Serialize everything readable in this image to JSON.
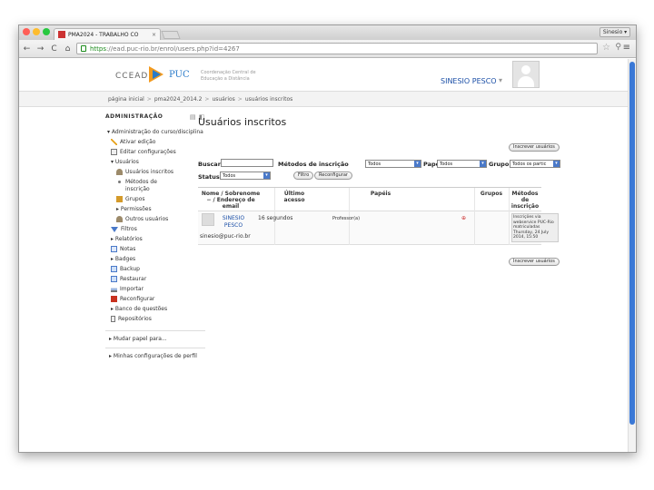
{
  "browser": {
    "tab_title": "PMA2024 - TRABALHO CO",
    "tab_close": "×",
    "user_badge": "Sinesio ▾",
    "url_scheme": "https",
    "url_rest": "://ead.puc-rio.br/enrol/users.php?id=4267",
    "back": "←",
    "forward": "→",
    "reload": "C",
    "home": "⌂",
    "star": "☆",
    "zoom": "⚲",
    "menu": "≡",
    "colors": {
      "close": "#ff5f57",
      "min": "#febc2e",
      "max": "#28c840"
    }
  },
  "header": {
    "logo_left": "CCEAD",
    "logo_right": "PUC",
    "logo_sub": "Coordenação Central de Educação a Distância",
    "username": "SINESIO PESCO",
    "user_chevron": "▾"
  },
  "breadcrumb": [
    "página inicial",
    "pma2024_2014.2",
    "usuários",
    "usuários inscritos"
  ],
  "sidebar": {
    "title": "ADMINISTRAÇÃO",
    "icons": "▤ ◧",
    "items": [
      {
        "label": "▾ Administração do curso/disciplina",
        "indent": 0
      },
      {
        "label": "Ativar edição",
        "indent": 1,
        "icon": "pencil-icon"
      },
      {
        "label": "Editar configurações",
        "indent": 1,
        "icon": "settings-icon"
      },
      {
        "label": "▾ Usuários",
        "indent": 1
      },
      {
        "label": "Usuários inscritos",
        "indent": 2,
        "icon": "user-icon"
      },
      {
        "label": "Métodos de inscrição",
        "indent": 2,
        "icon": "bullet-icon"
      },
      {
        "label": "Grupos",
        "indent": 2,
        "icon": "group-icon"
      },
      {
        "label": "▸ Permissões",
        "indent": 2
      },
      {
        "label": "Outros usuários",
        "indent": 2,
        "icon": "user-icon"
      },
      {
        "label": "Filtros",
        "indent": 1,
        "icon": "filter-icon"
      },
      {
        "label": "▸ Relatórios",
        "indent": 1
      },
      {
        "label": "Notas",
        "indent": 1,
        "icon": "grades-icon"
      },
      {
        "label": "▸ Badges",
        "indent": 1
      },
      {
        "label": "Backup",
        "indent": 1,
        "icon": "backup-icon"
      },
      {
        "label": "Restaurar",
        "indent": 1,
        "icon": "restore-icon"
      },
      {
        "label": "Importar",
        "indent": 1,
        "icon": "import-icon"
      },
      {
        "label": "Reconfigurar",
        "indent": 1,
        "icon": "reset-icon"
      },
      {
        "label": "▸ Banco de questões",
        "indent": 1
      },
      {
        "label": "Repositórios",
        "indent": 1,
        "icon": "repo-icon"
      }
    ],
    "extra": [
      "▸ Mudar papel para...",
      "▸ Minhas configurações de perfil"
    ]
  },
  "main": {
    "title": "Usuários inscritos",
    "enrol_button": "Inscrever usuários",
    "search_label": "Buscar",
    "methods_label": "Métodos de inscrição",
    "methods_value": "Todos",
    "role_label": "Papel",
    "role_value": "Todos",
    "group_label": "Grupo",
    "group_value": "Todos os partic",
    "status_label": "Status",
    "status_value": "Todos",
    "filter_button": "Filtro",
    "reset_button": "Reconfigurar",
    "columns": {
      "name": "Nome / Sobrenome",
      "name_sort": "−",
      "email": "/ Endereço de email",
      "access": "Último acesso",
      "roles": "Papéis",
      "groups": "Grupos",
      "methods": "Métodos de inscrição"
    },
    "row": {
      "first": "SINESIO",
      "last": "PESCO",
      "email": "sinesio@puc-rio.br",
      "access": "16 segundos",
      "role": "Professor(a)",
      "group_add": "⊕",
      "method": "Inscrições via webservice PUC-Rio matriculadas Thursday, 24 July 2014, 15:50"
    }
  }
}
